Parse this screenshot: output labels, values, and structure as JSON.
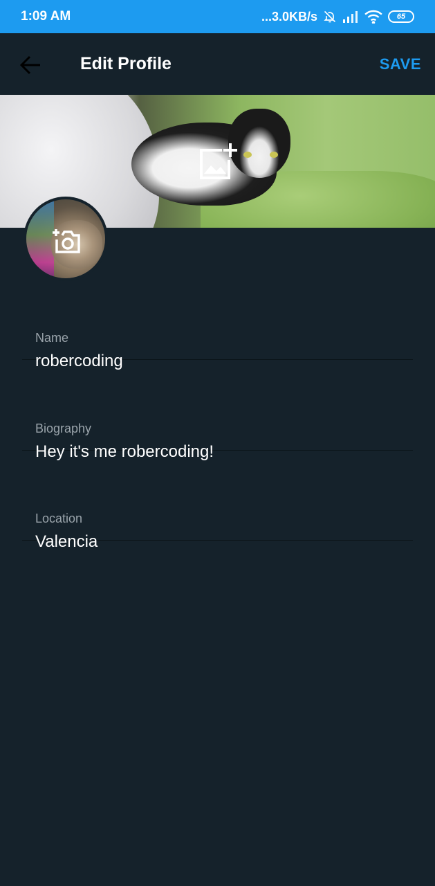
{
  "status_bar": {
    "time": "1:09 AM",
    "network_speed": "...3.0KB/s",
    "battery_level": "65",
    "icons": [
      "bell-off-icon",
      "signal-icon",
      "wifi-icon",
      "battery-icon"
    ]
  },
  "toolbar": {
    "title": "Edit Profile",
    "save_label": "SAVE",
    "back_icon": "arrow-left-icon"
  },
  "header": {
    "banner_action_icon": "add-photo-icon",
    "avatar_action_icon": "add-camera-icon"
  },
  "form": {
    "fields": [
      {
        "label": "Name",
        "value": "robercoding"
      },
      {
        "label": "Biography",
        "value": "Hey it's me robercoding!"
      },
      {
        "label": "Location",
        "value": "Valencia"
      }
    ]
  },
  "colors": {
    "status_bar": "#1d9bf0",
    "background": "#15222b",
    "accent": "#1d9bf0",
    "label": "#9aa4ab",
    "text": "#ffffff"
  }
}
